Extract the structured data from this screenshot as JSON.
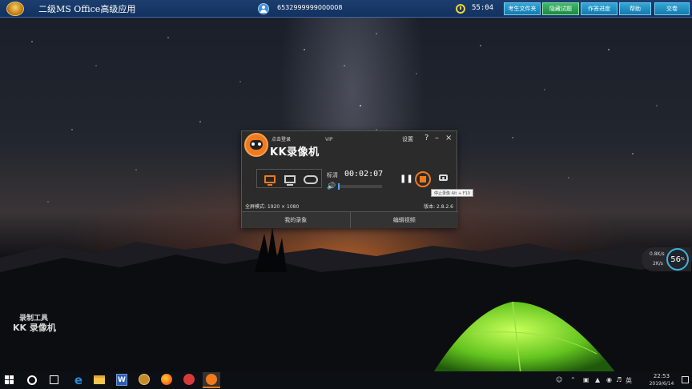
{
  "exam_bar": {
    "title": "二级MS Office高级应用",
    "exam_id": "6532999999000008",
    "timer": "55:04",
    "buttons": [
      "考生文件夹",
      "隐藏试题",
      "作答进度",
      "帮助",
      "交卷"
    ]
  },
  "recorder": {
    "login_text": "点击登录",
    "brand": "KK录像机",
    "vip": "VIP",
    "settings": "设置",
    "help": "?",
    "minimize": "–",
    "close": "×",
    "quality": "标清",
    "record_time": "00:02:07",
    "stop_tooltip": "停止录像 Alt + F10",
    "fullscreen_mode": "全屏模式: 1920 × 1080",
    "version": "版本: 2.8.2.6",
    "tabs": [
      "我的录象",
      "编辑视频"
    ]
  },
  "watermark": {
    "line1": "录制工具",
    "line2": "KK 录像机"
  },
  "net_widget": {
    "upload": "0.8K/s",
    "download": "2K/s",
    "percent": "56",
    "percent_unit": "%"
  },
  "taskbar": {
    "ime": "英",
    "time": "22:53",
    "date": "2019/6/14"
  },
  "icons": {
    "taskbar": [
      "start-icon",
      "search-icon",
      "task-view-icon",
      "edge-icon",
      "file-explorer-icon",
      "word-icon",
      "exam-app-icon",
      "firefox-icon",
      "netease-music-icon",
      "kk-recorder-icon"
    ],
    "tray": [
      "people-icon",
      "network-icon",
      "security-icon",
      "wifi-icon",
      "volume-icon",
      "ime-icon"
    ]
  },
  "colors": {
    "accent_orange": "#f07a1c",
    "exam_bar_blue": "#123260",
    "exam_button_cyan": "#1479ad",
    "exam_button_green": "#1c8a44"
  }
}
